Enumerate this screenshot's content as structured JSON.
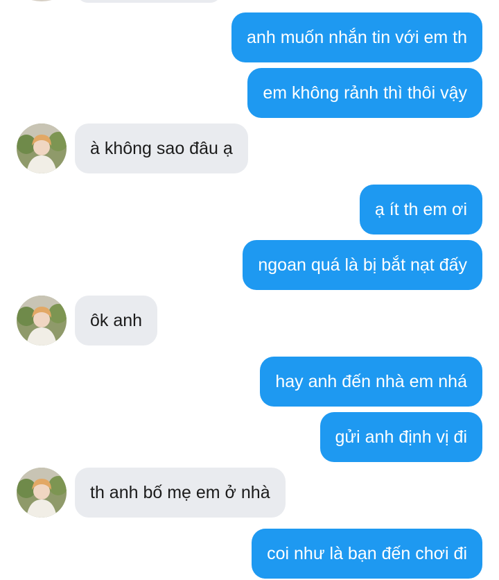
{
  "conversation": {
    "messages": [
      {
        "sender": "me",
        "text": "anh muốn nhắn tin với em th"
      },
      {
        "sender": "me",
        "text": "em không rảnh thì thôi vậy"
      },
      {
        "sender": "other",
        "text": "à không sao đâu ạ"
      },
      {
        "sender": "me",
        "text": "ạ ít th em ơi"
      },
      {
        "sender": "me",
        "text": "ngoan quá là bị bắt nạt đấy"
      },
      {
        "sender": "other",
        "text": "ôk anh"
      },
      {
        "sender": "me",
        "text": "hay anh đến nhà em nhá"
      },
      {
        "sender": "me",
        "text": "gửi anh định vị đi"
      },
      {
        "sender": "other",
        "text": "th anh bố mẹ em ở nhà"
      },
      {
        "sender": "me",
        "text": "coi như là bạn đến chơi đi"
      }
    ]
  },
  "colors": {
    "sent_bubble": "#1e99f1",
    "received_bubble": "#e9ebef",
    "sent_text": "#ffffff",
    "received_text": "#1b1b1b"
  }
}
